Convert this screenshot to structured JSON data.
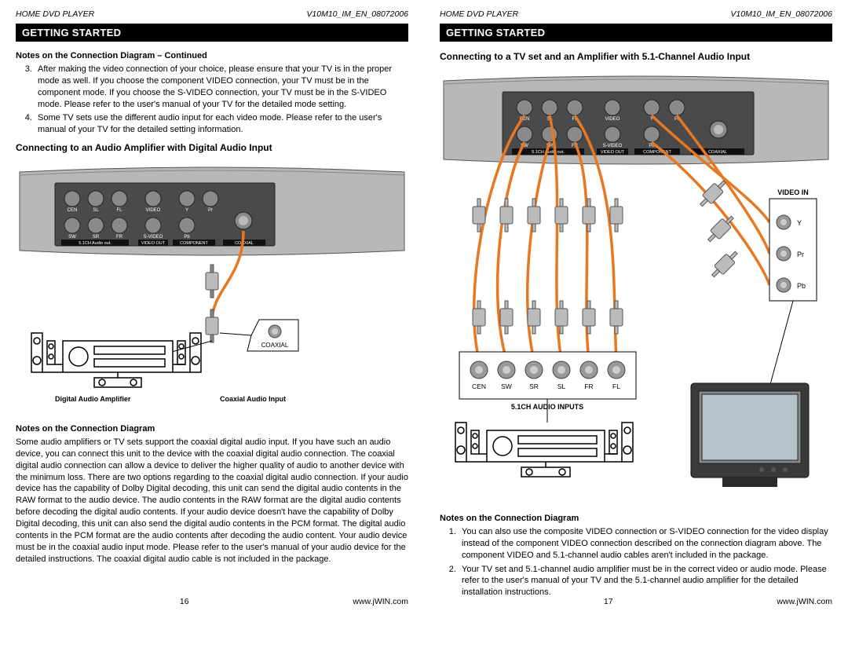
{
  "header": {
    "product": "HOME DVD PLAYER",
    "doc_id": "V10M10_IM_EN_08072006"
  },
  "section_title": "GETTING STARTED",
  "left_page": {
    "notes_continued_title": "Notes on the Connection Diagram – Continued",
    "note3": "After making the video connection of your choice, please ensure that your TV is in the proper mode as well. If you choose the component VIDEO connection, your TV must be in the component mode. If you choose the S-VIDEO connection, your TV must be in the S-VIDEO mode. Please refer to the user's manual of your TV for the detailed mode setting.",
    "note4": "Some TV sets use the different audio input for each video mode. Please refer to the user's manual of your TV for the detailed setting information.",
    "connect_digital_title": "Connecting to an Audio Amplifier with Digital Audio Input",
    "diagram_labels": {
      "cen": "CEN",
      "sl": "SL",
      "fl": "FL",
      "video": "VIDEO",
      "y": "Y",
      "pr": "Pr",
      "sw": "SW",
      "sr": "SR",
      "fr": "FR",
      "svideo": "S-VIDEO",
      "pb": "Pb",
      "audio_out_block": "5.1CH Audio out.",
      "video_out_block": "VIDEO OUT",
      "component_block": "COMPONENT",
      "coaxial_block": "COAXIAL",
      "coaxial_callout": "COAXIAL",
      "digital_amp_label": "Digital Audio Amplifier",
      "coaxial_input_label": "Coaxial Audio Input"
    },
    "notes_title": "Notes on the Connection Diagram",
    "notes_body": "Some audio amplifiers or TV sets support the coaxial digital audio input. If you have such an audio device, you can connect this unit to the device with the coaxial digital audio connection. The coaxial digital audio connection can allow a device to deliver the higher quality of audio to another device with the minimum loss. There are two options regarding to the coaxial digital audio connection. If your audio device has the capability of Dolby Digital decoding, this unit can send the digital audio contents in the RAW format to the audio device. The audio contents in the RAW format are the digital audio contents before decoding the digital audio contents. If your audio device doesn't have the capability of Dolby Digital decoding, this unit can also send the digital audio contents in the PCM format. The digital audio contents in the PCM format are the audio contents after decoding the audio content. Your audio device must be in the coaxial audio input mode. Please refer to the user's manual of your audio device for the detailed instructions. The coaxial digital audio cable is not included in the package.",
    "page_number": "16"
  },
  "right_page": {
    "connect_51_title": "Connecting to a TV set and an Amplifier with 5.1-Channel Audio Input",
    "diagram_labels": {
      "cen": "CEN",
      "sl": "SL",
      "fl": "FL",
      "video": "VIDEO",
      "y": "Y",
      "pr": "Pr",
      "sw": "SW",
      "sr": "SR",
      "fr": "FR",
      "svideo": "S-VIDEO",
      "pb": "Pb",
      "audio_out_block": "5.1CH Audio out.",
      "video_out_block": "VIDEO OUT",
      "component_block": "COMPONENT",
      "coaxial_block": "COAXIAL",
      "video_in_box": "VIDEO IN",
      "vin_y": "Y",
      "vin_pr": "Pr",
      "vin_pb": "Pb",
      "inputs_row": {
        "cen": "CEN",
        "sw": "SW",
        "sr": "SR",
        "sl": "SL",
        "fr": "FR",
        "fl": "FL"
      },
      "inputs_title": "5.1CH AUDIO INPUTS"
    },
    "notes_title": "Notes on the Connection Diagram",
    "note1": "You can also use the composite VIDEO connection or S-VIDEO connection for the video display instead of the component VIDEO connection described on the connection diagram above. The component VIDEO and 5.1-channel audio cables aren't included in the package.",
    "note2": "Your TV set and 5.1-channel audio amplifier must be in the correct video or audio mode. Please refer to the user's manual of your TV and the 5.1-channel audio amplifier for the detailed installation instructions.",
    "page_number": "17"
  },
  "footer_url": "www.jWIN.com"
}
